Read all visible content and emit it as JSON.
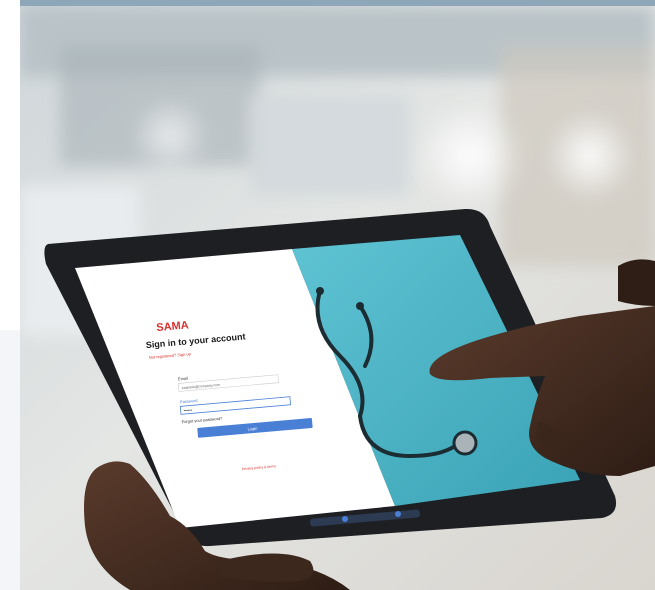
{
  "photo": {
    "description_icon": "tablet-photo",
    "login": {
      "brand": "SAMA",
      "heading": "Sign in to your account",
      "subheading": "Not registered? Sign up",
      "email_label": "Email",
      "email_value": "example@company.com",
      "password_label": "Password",
      "password_value": "••••••",
      "forgot_link": "Forgot your password?",
      "login_button": "Login",
      "footer_link": "Privacy policy & terms"
    },
    "colors": {
      "brand_red": "#d8322f",
      "button_blue": "#4a7fd6",
      "screen_teal": "#4cb7c9"
    }
  }
}
